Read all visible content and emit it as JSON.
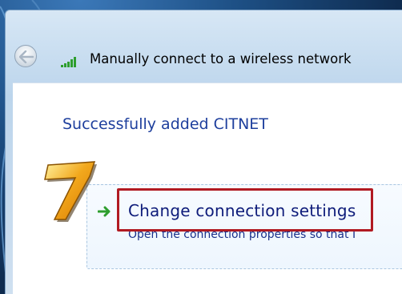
{
  "window": {
    "title": "Manually connect to a wireless network"
  },
  "header": {
    "back_button_icon": "back-arrow-icon",
    "signal_icon": "wireless-signal-icon"
  },
  "main": {
    "heading": "Successfully added CITNET",
    "option": {
      "icon": "green-arrow-icon",
      "title": "Change connection settings",
      "description": "Open the connection properties so that I"
    }
  },
  "annotation": {
    "step_number": "7",
    "highlight_color": "#b11a22"
  },
  "colors": {
    "heading": "#1e3f9d",
    "link": "#0e1c7a",
    "arrow": "#2e9e2e",
    "step_fill": "#f2a81d"
  }
}
